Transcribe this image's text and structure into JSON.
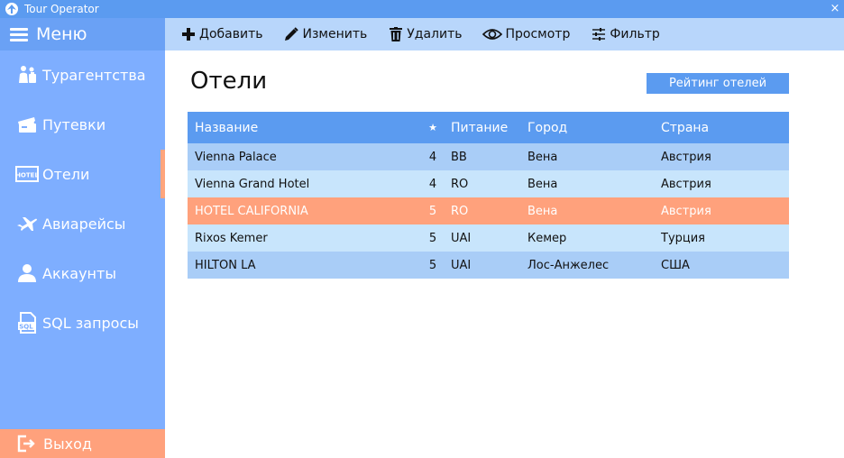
{
  "window": {
    "title": "Tour Operator",
    "close_glyph": "×"
  },
  "sidebar": {
    "menu_label": "Меню",
    "items": [
      {
        "label": "Турагентства",
        "icon": "agency-icon"
      },
      {
        "label": "Путевки",
        "icon": "tickets-icon"
      },
      {
        "label": "Отели",
        "icon": "hotel-icon"
      },
      {
        "label": "Авиарейсы",
        "icon": "airplane-icon"
      },
      {
        "label": "Аккаунты",
        "icon": "user-icon"
      },
      {
        "label": "SQL запросы",
        "icon": "sql-file-icon"
      }
    ],
    "active_index": 2,
    "exit_label": "Выход"
  },
  "toolbar": {
    "add": "Добавить",
    "edit": "Изменить",
    "delete": "Удалить",
    "view": "Просмотр",
    "filter": "Фильтр"
  },
  "main": {
    "title": "Отели",
    "rating_button": "Рейтинг отелей"
  },
  "table": {
    "headers": {
      "name": "Название",
      "stars": "★",
      "food": "Питание",
      "city": "Город",
      "country": "Страна"
    },
    "rows": [
      {
        "name": "Vienna Palace",
        "stars": "4",
        "food": "BB",
        "city": "Вена",
        "country": "Австрия"
      },
      {
        "name": "Vienna Grand Hotel",
        "stars": "4",
        "food": "RO",
        "city": "Вена",
        "country": "Австрия"
      },
      {
        "name": "HOTEL CALIFORNIA",
        "stars": "5",
        "food": "RO",
        "city": "Вена",
        "country": "Австрия"
      },
      {
        "name": "Rixos Kemer",
        "stars": "5",
        "food": "UAI",
        "city": "Кемер",
        "country": "Турция"
      },
      {
        "name": "HILTON LA",
        "stars": "5",
        "food": "UAI",
        "city": "Лос-Анжелес",
        "country": "США"
      }
    ],
    "selected_index": 2
  },
  "colors": {
    "accent": "#5b9bf0",
    "sidebar": "#7eaeff",
    "selection": "#ffa17c",
    "toolbar": "#b8d6fb",
    "row_odd": "#a9cdf7",
    "row_even": "#c8e5fc"
  }
}
